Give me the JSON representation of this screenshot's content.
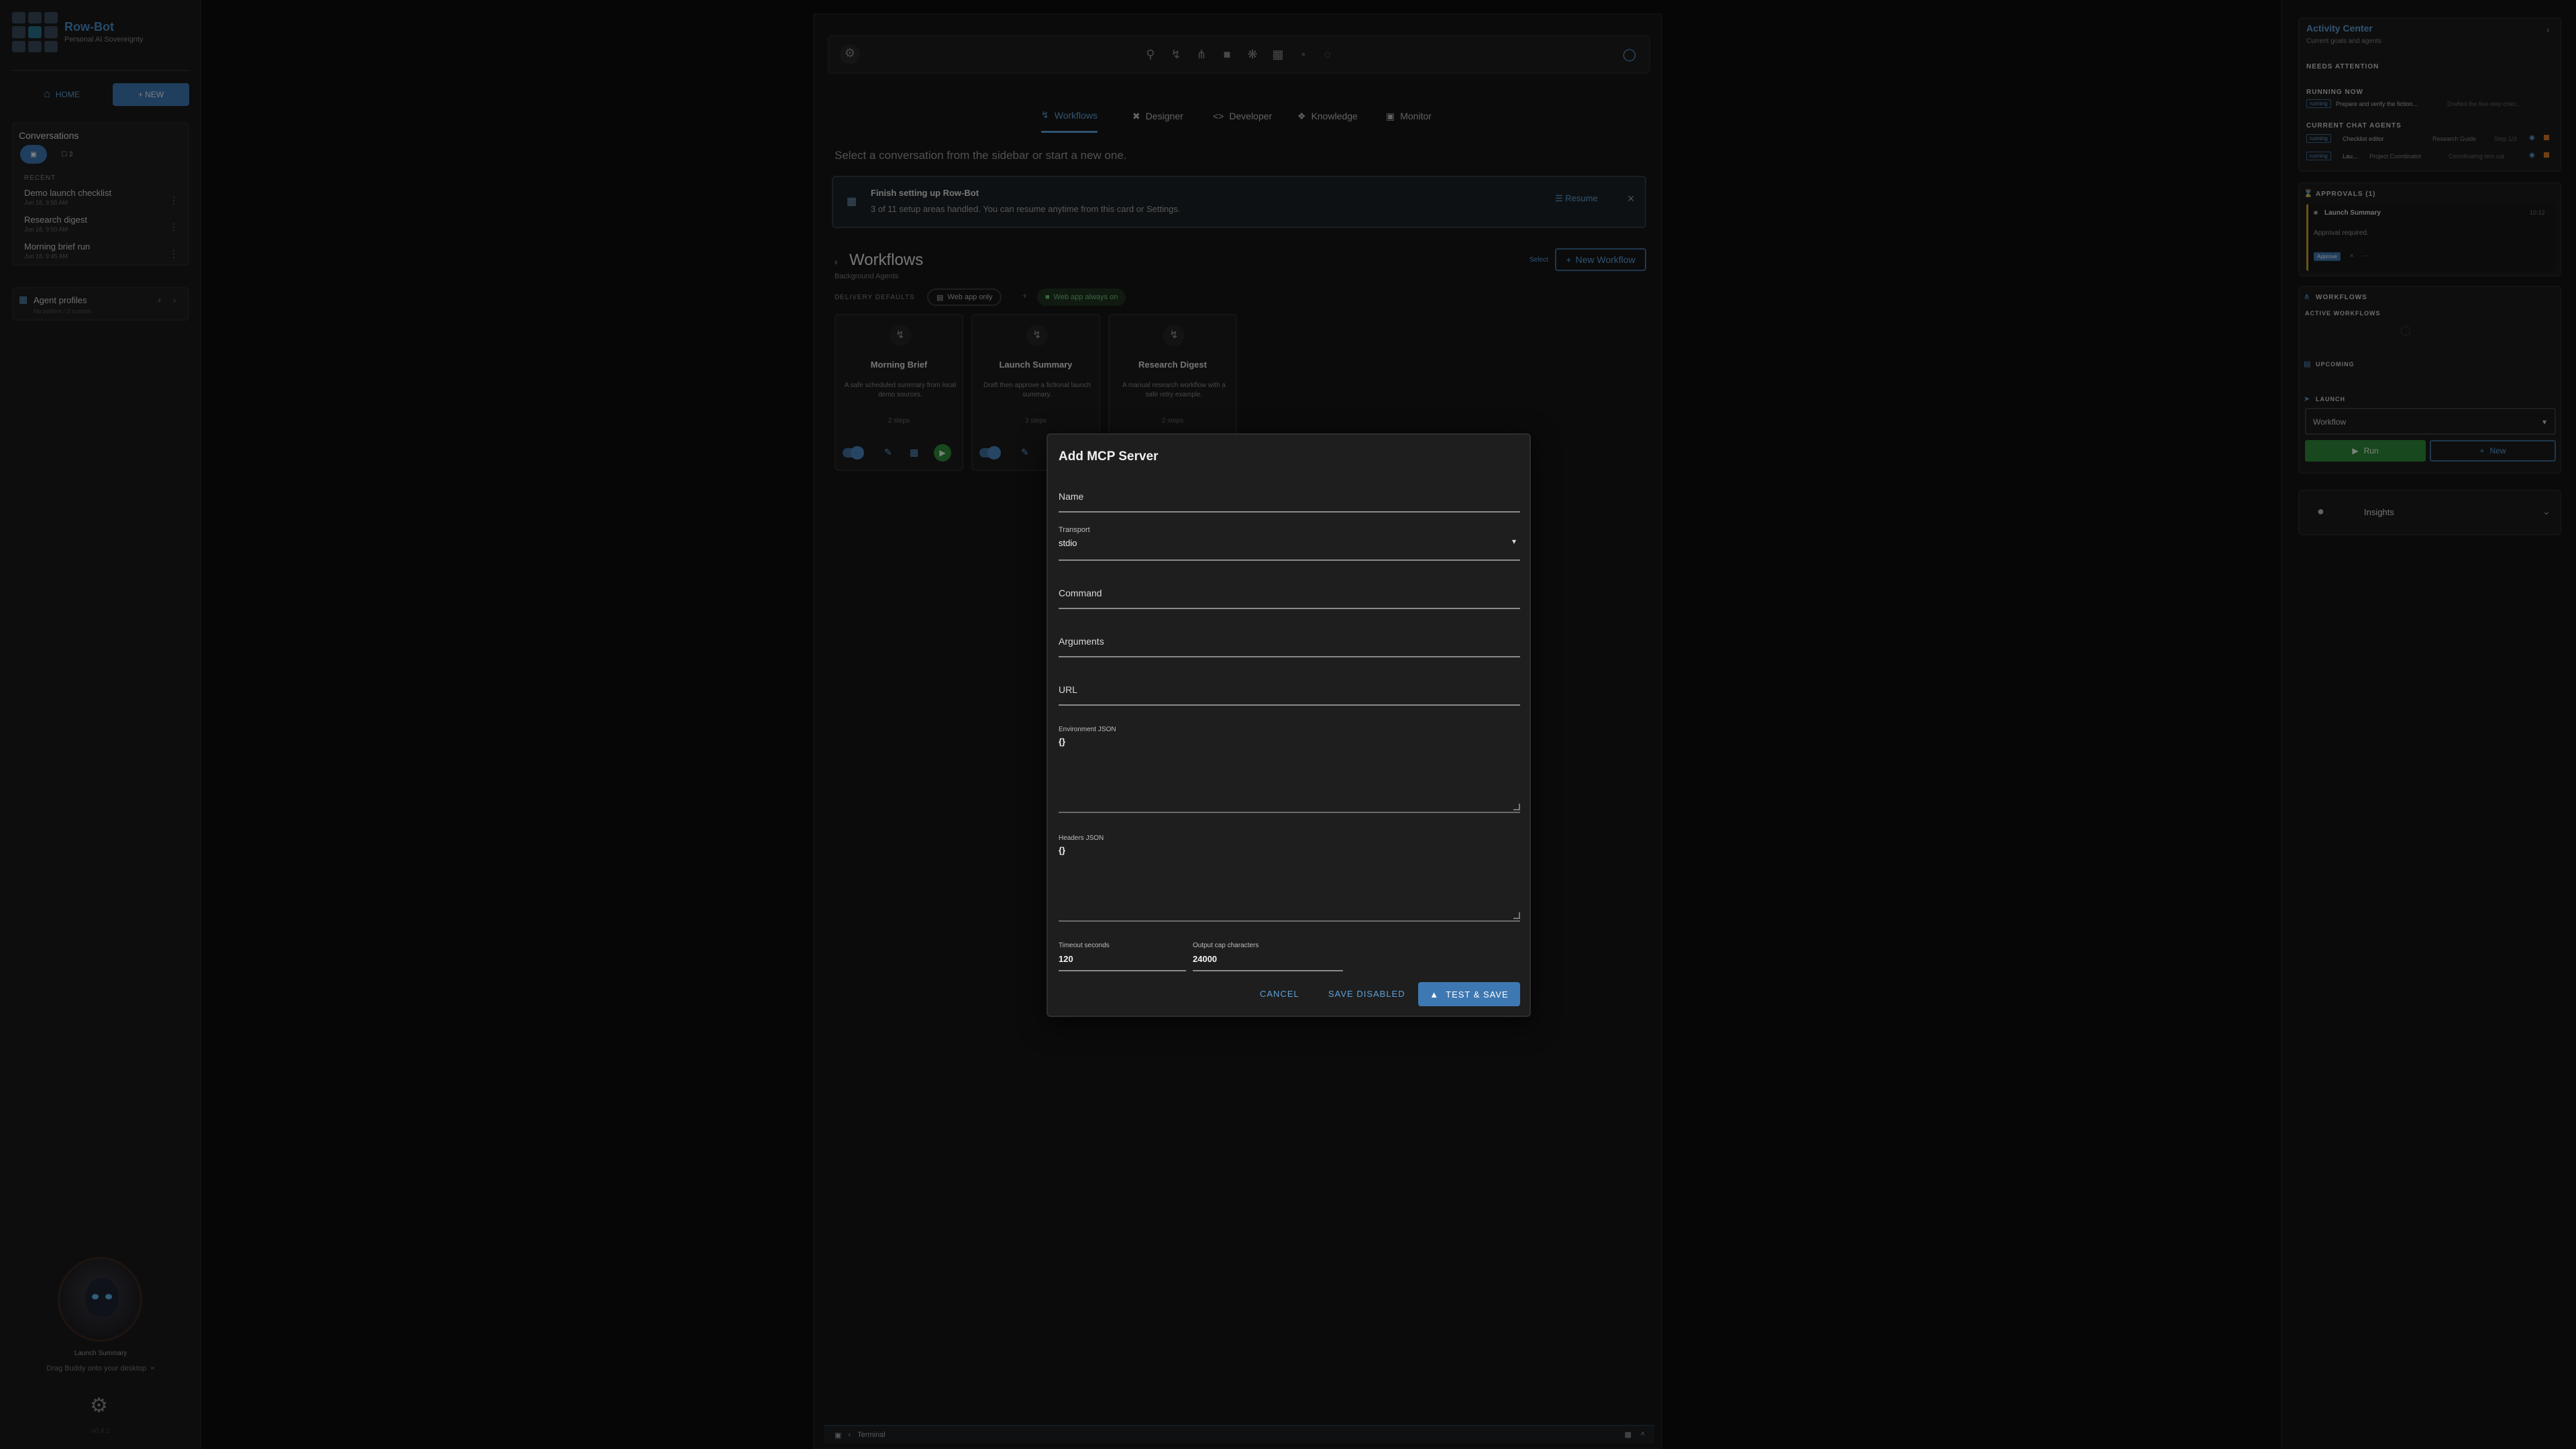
{
  "app": {
    "name": "Row-Bot",
    "subtitle": "Personal AI Sovereignty"
  },
  "sidebar": {
    "home_label": "HOME",
    "new_label": "+ NEW",
    "conversations_title": "Conversations",
    "chip_count": "2",
    "recent_label": "RECENT",
    "conversations": [
      {
        "title": "Demo launch checklist",
        "date": "Jun 18, 9:55 AM"
      },
      {
        "title": "Research digest",
        "date": "Jun 18, 9:50 AM"
      },
      {
        "title": "Morning brief run",
        "date": "Jun 18, 9:45 AM"
      }
    ],
    "agent_profiles_title": "Agent profiles",
    "agent_profiles_sub": "No builtins / 3 custom",
    "buddy_name": "Launch Summary",
    "drag_text": "Drag Buddy onto your desktop",
    "version": "v0.4.2"
  },
  "main": {
    "tabs": [
      {
        "label": "Workflows",
        "active": true
      },
      {
        "label": "Designer"
      },
      {
        "label": "Developer"
      },
      {
        "label": "Knowledge"
      },
      {
        "label": "Monitor"
      }
    ],
    "select_message": "Select a conversation from the sidebar or start a new one.",
    "setup_title": "Finish setting up Row-Bot",
    "setup_subtitle": "3 of 11 setup areas handled. You can resume anytime from this card or Settings.",
    "resume_label": "Resume",
    "workflows_title": "Workflows",
    "workflows_subtitle": "Background Agents",
    "delivery_label": "DELIVERY DEFAULTS",
    "delivery_pill": "Web app only",
    "web_pill": "Web app always on",
    "select_label": "Select",
    "new_workflow_label": "New Workflow",
    "cards": [
      {
        "name": "Morning Brief",
        "desc": "A safe scheduled summary from local demo sources.",
        "steps": "2 steps"
      },
      {
        "name": "Launch Summary",
        "desc": "Draft then approve a fictional launch summary.",
        "steps": "3 steps"
      },
      {
        "name": "Research Digest",
        "desc": "A manual research workflow with a safe retry example.",
        "steps": "2 steps"
      }
    ],
    "terminal_label": "Terminal"
  },
  "modal": {
    "title": "Add MCP Server",
    "name_label": "Name",
    "transport_label": "Transport",
    "transport_value": "stdio",
    "command_label": "Command",
    "arguments_label": "Arguments",
    "url_label": "URL",
    "env_label": "Environment JSON",
    "env_value": "{}",
    "headers_label": "Headers JSON",
    "headers_value": "{}",
    "timeout_label": "Timeout seconds",
    "timeout_value": "120",
    "output_cap_label": "Output cap characters",
    "output_cap_value": "24000",
    "cancel_label": "CANCEL",
    "save_disabled_label": "SAVE DISABLED",
    "test_save_label": "TEST & SAVE"
  },
  "right_panel": {
    "title": "Activity Center",
    "subtitle": "Current goals and agents",
    "needs_attention": "NEEDS ATTENTION",
    "running_now": "RUNNING NOW",
    "running_item": "Prepare and verify the fiction...",
    "running_item_meta": "Drafted the five-step chec...",
    "current_chat_agents": "CURRENT CHAT AGENTS",
    "agents": [
      {
        "tag": "running",
        "name": "Checklist editor",
        "role": "Research Guide",
        "meta": "Step 1/3"
      },
      {
        "tag": "running",
        "name": "Lau...",
        "role": "Project Coordinator",
        "meta": "Coordinating tem cat"
      }
    ],
    "approvals_title": "APPROVALS (1)",
    "approval_name": "Launch Summary",
    "approval_time": "10:12",
    "approval_text": "Approval required.",
    "approve_label": "Approve",
    "workflows_title": "WORKFLOWS",
    "active_workflows": "ACTIVE WORKFLOWS",
    "upcoming": "UPCOMING",
    "launch": "LAUNCH",
    "workflow_select": "Workflow",
    "run_label": "Run",
    "new_label": "New",
    "insights_label": "Insights"
  }
}
